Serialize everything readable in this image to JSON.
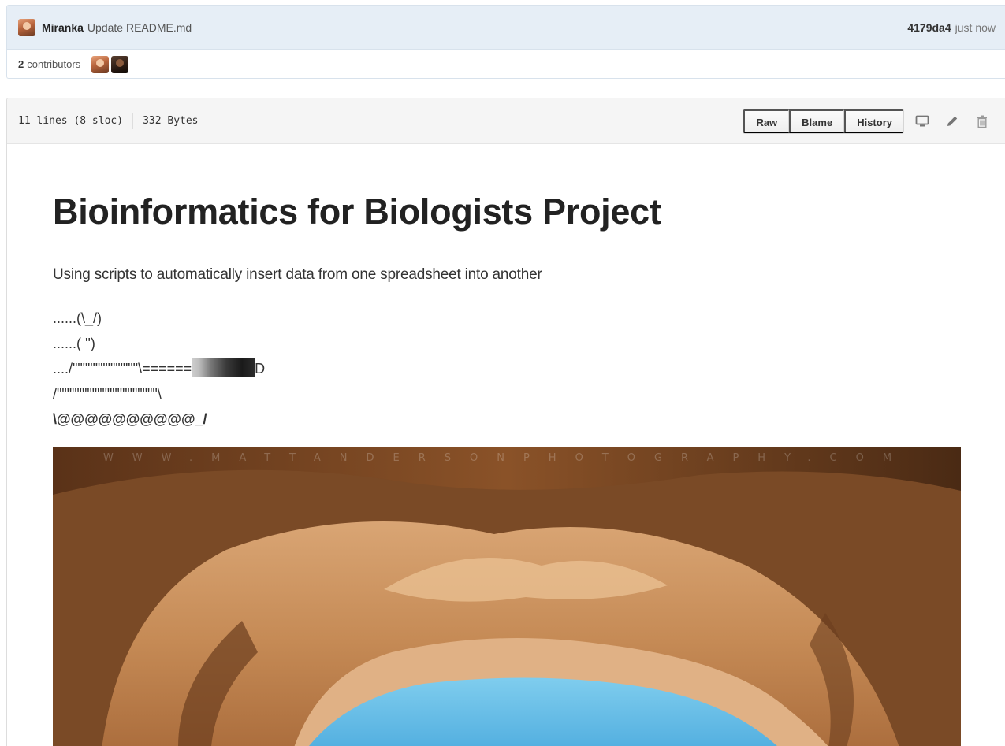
{
  "commit": {
    "author": "Miranka",
    "message": "Update README.md",
    "sha": "4179da4",
    "time": "just now"
  },
  "contributors": {
    "count": "2",
    "label": "contributors"
  },
  "file": {
    "lines": "11 lines (8 sloc)",
    "size": "332 Bytes",
    "buttons": {
      "raw": "Raw",
      "blame": "Blame",
      "history": "History"
    }
  },
  "icons": {
    "desktop": "desktop-icon",
    "edit": "pencil-icon",
    "delete": "trash-icon"
  },
  "readme": {
    "title": "Bioinformatics for Biologists Project",
    "description": "Using scripts to automatically insert data from one spreadsheet into another",
    "ascii": {
      "line1": "......(\\_/)",
      "line2": "......( '')",
      "line3_left": "..../\"\"\"\"\"\"\"\"\"\"\"\"\"\\======",
      "line3_right": "D",
      "line4": "/\"\"\"\"\"\"\"\"\"\"\"\"\"\"\"\"\"\"\"\"\\",
      "line5": "\\@@@@@@@@@@_/"
    },
    "image": {
      "watermark": "WWW.MATTANDERSONPHOTOGRAPHY.COM"
    }
  }
}
